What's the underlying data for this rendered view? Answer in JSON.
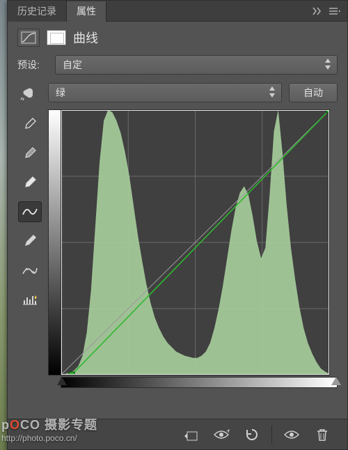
{
  "tabs": {
    "history": "历史记录",
    "properties": "属性"
  },
  "header": {
    "title": "曲线"
  },
  "preset": {
    "label": "预设:",
    "value": "自定"
  },
  "channel": {
    "value": "绿",
    "auto": "自动"
  },
  "colors": {
    "curve": "#2eb82e",
    "histogram": "#a8cf9d"
  },
  "chart_data": {
    "type": "line",
    "title": "",
    "xlabel": "",
    "ylabel": "",
    "xlim": [
      0,
      255
    ],
    "ylim": [
      0,
      255
    ],
    "grid": true,
    "series": [
      {
        "name": "curve",
        "x": [
          10,
          255
        ],
        "y": [
          0,
          255
        ]
      },
      {
        "name": "baseline",
        "x": [
          0,
          255
        ],
        "y": [
          0,
          255
        ]
      }
    ],
    "control_points": [
      {
        "x": 10,
        "y": 0
      },
      {
        "x": 255,
        "y": 255
      }
    ],
    "histogram": {
      "bins": 64,
      "values": [
        0,
        1,
        2,
        4,
        8,
        18,
        40,
        80,
        140,
        200,
        240,
        250,
        248,
        240,
        228,
        210,
        188,
        160,
        132,
        108,
        86,
        68,
        54,
        44,
        36,
        30,
        26,
        22,
        20,
        18,
        17,
        16,
        16,
        18,
        22,
        30,
        44,
        62,
        84,
        110,
        136,
        158,
        172,
        178,
        170,
        150,
        126,
        110,
        120,
        170,
        230,
        250,
        210,
        160,
        120,
        90,
        64,
        44,
        30,
        20,
        12,
        6,
        3,
        1
      ]
    },
    "sliders": {
      "black": 0,
      "white": 255
    }
  },
  "watermark": {
    "brand_left": "p",
    "brand_mid": "O",
    "brand_right": "CO",
    "line1": "摄影专题",
    "line2": "http://photo.poco.cn/"
  }
}
